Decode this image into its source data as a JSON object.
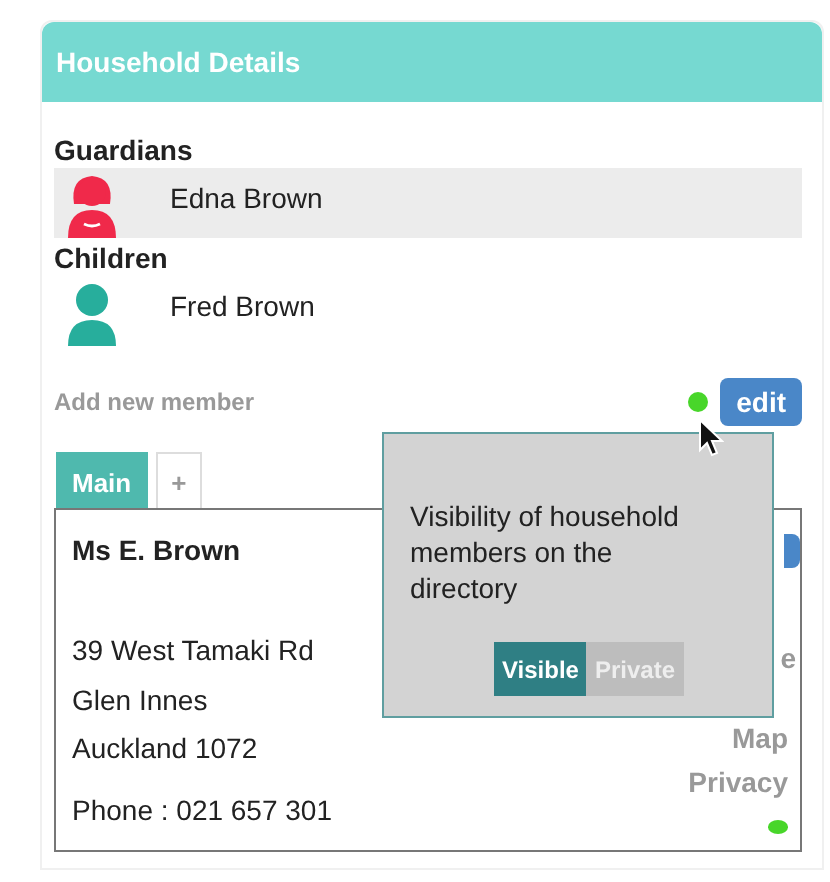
{
  "header": {
    "title": "Household Details"
  },
  "groups": [
    {
      "label": "Guardians",
      "members": [
        {
          "name": "Edna Brown",
          "kind": "female",
          "color": "#f0294a",
          "selected": true
        }
      ]
    },
    {
      "label": "Children",
      "members": [
        {
          "name": "Fred Brown",
          "kind": "male",
          "color": "#27ae9c",
          "selected": false
        }
      ]
    }
  ],
  "add_member": "Add new member",
  "edit_button": "edit",
  "tabs": [
    {
      "label": "Main",
      "selected": true
    },
    {
      "label": "+",
      "selected": false
    }
  ],
  "contact": {
    "name": "Ms E. Brown",
    "address": [
      "39 West Tamaki Rd",
      "Glen Innes",
      "Auckland 1072"
    ],
    "phone": "Phone : 021 657 301",
    "links": [
      "e",
      "Map",
      "Privacy"
    ]
  },
  "popover": {
    "text": "Visibility of household members on the directory",
    "options": [
      {
        "label": "Visible",
        "selected": true
      },
      {
        "label": "Private",
        "selected": false
      }
    ]
  }
}
